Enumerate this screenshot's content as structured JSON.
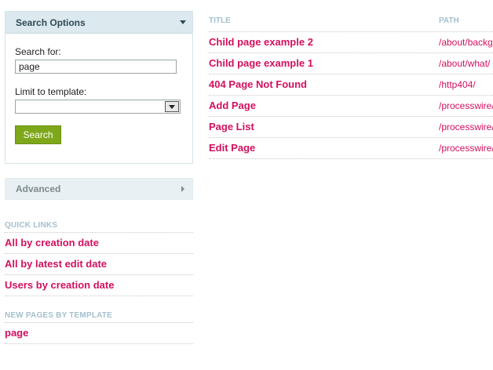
{
  "search_panel": {
    "title": "Search Options",
    "search_label": "Search for:",
    "search_value": "page",
    "template_label": "Limit to template:",
    "template_value": "",
    "search_button": "Search"
  },
  "advanced": {
    "title": "Advanced"
  },
  "quick_links": {
    "heading": "QUICK LINKS",
    "items": [
      "All by creation date",
      "All by latest edit date",
      "Users by creation date"
    ]
  },
  "new_pages": {
    "heading": "NEW PAGES BY TEMPLATE",
    "items": [
      "page"
    ]
  },
  "results": {
    "headers": {
      "title": "TITLE",
      "path": "PATH"
    },
    "rows": [
      {
        "title": "Child page example 2",
        "path": "/about/background/"
      },
      {
        "title": "Child page example 1",
        "path": "/about/what/"
      },
      {
        "title": "404 Page Not Found",
        "path": "/http404/"
      },
      {
        "title": "Add Page",
        "path": "/processwire/page/add/"
      },
      {
        "title": "Page List",
        "path": "/processwire/page/list/"
      },
      {
        "title": "Edit Page",
        "path": "/processwire/page/edit/"
      }
    ]
  }
}
